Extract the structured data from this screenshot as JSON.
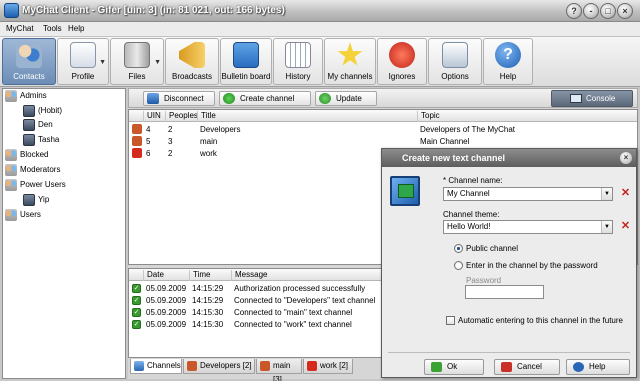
{
  "window": {
    "title": "MyChat Client - Gifer [uin: 3]   (in: 81 021, out: 166 bytes)",
    "controls": [
      "?",
      "-",
      "□",
      "×"
    ]
  },
  "menu": [
    "MyChat",
    "Tools",
    "Help"
  ],
  "toolbar": [
    {
      "label": "Contacts",
      "icon": "contacts-icon"
    },
    {
      "label": "Profile",
      "icon": "profile-icon"
    },
    {
      "label": "Files",
      "icon": "files-icon"
    },
    {
      "label": "Broadcasts",
      "icon": "broadcasts-icon"
    },
    {
      "label": "Bulletin board",
      "icon": "bulletin-board-icon"
    },
    {
      "label": "History",
      "icon": "history-icon"
    },
    {
      "label": "My channels",
      "icon": "star-icon"
    },
    {
      "label": "Ignores",
      "icon": "ignore-icon"
    },
    {
      "label": "Options",
      "icon": "options-icon"
    },
    {
      "label": "Help",
      "icon": "help-icon"
    }
  ],
  "tree": [
    {
      "label": "Admins",
      "type": "group"
    },
    {
      "label": "(Hobit)",
      "type": "user"
    },
    {
      "label": "Den",
      "type": "user"
    },
    {
      "label": "Tasha",
      "type": "user"
    },
    {
      "label": "Blocked",
      "type": "group"
    },
    {
      "label": "Moderators",
      "type": "group"
    },
    {
      "label": "Power Users",
      "type": "group"
    },
    {
      "label": "Yip",
      "type": "user"
    },
    {
      "label": "Users",
      "type": "group"
    }
  ],
  "actions": {
    "disconnect": "Disconnect",
    "create_channel": "Create channel",
    "update": "Update",
    "console": "Console"
  },
  "channels": {
    "headers": [
      "UIN",
      "Peoples",
      "Title",
      "Topic"
    ],
    "rows": [
      {
        "uin": "4",
        "peoples": "2",
        "title": "Developers",
        "topic": "Developers of The MyChat",
        "color": "#c9572a"
      },
      {
        "uin": "5",
        "peoples": "3",
        "title": "main",
        "topic": "Main Channel",
        "color": "#c9572a"
      },
      {
        "uin": "6",
        "peoples": "2",
        "title": "work",
        "topic": "",
        "color": "#d42b1e"
      }
    ]
  },
  "log": {
    "headers": [
      "Date",
      "Time",
      "Message"
    ],
    "rows": [
      {
        "date": "05.09.2009",
        "time": "14:15:29",
        "message": "Authorization processed successfully"
      },
      {
        "date": "05.09.2009",
        "time": "14:15:29",
        "message": "Connected to \"Developers\" text channel"
      },
      {
        "date": "05.09.2009",
        "time": "14:15:30",
        "message": "Connected to \"main\" text channel"
      },
      {
        "date": "05.09.2009",
        "time": "14:15:30",
        "message": "Connected to \"work\" text channel"
      }
    ]
  },
  "tabs": [
    "Channels",
    "Developers [2]",
    "main [3]",
    "work [2]"
  ],
  "dialog": {
    "title": "Create new text channel",
    "channel_name_label": "* Channel name:",
    "channel_name_value": "My Channel",
    "channel_theme_label": "Channel theme:",
    "channel_theme_value": "Hello World!",
    "public_label": "Public channel",
    "password_option_label": "Enter in the channel by the password",
    "password_label": "Password",
    "auto_enter_label": "Automatic entering to this channel in the future",
    "ok": "Ok",
    "cancel": "Cancel",
    "help": "Help"
  }
}
